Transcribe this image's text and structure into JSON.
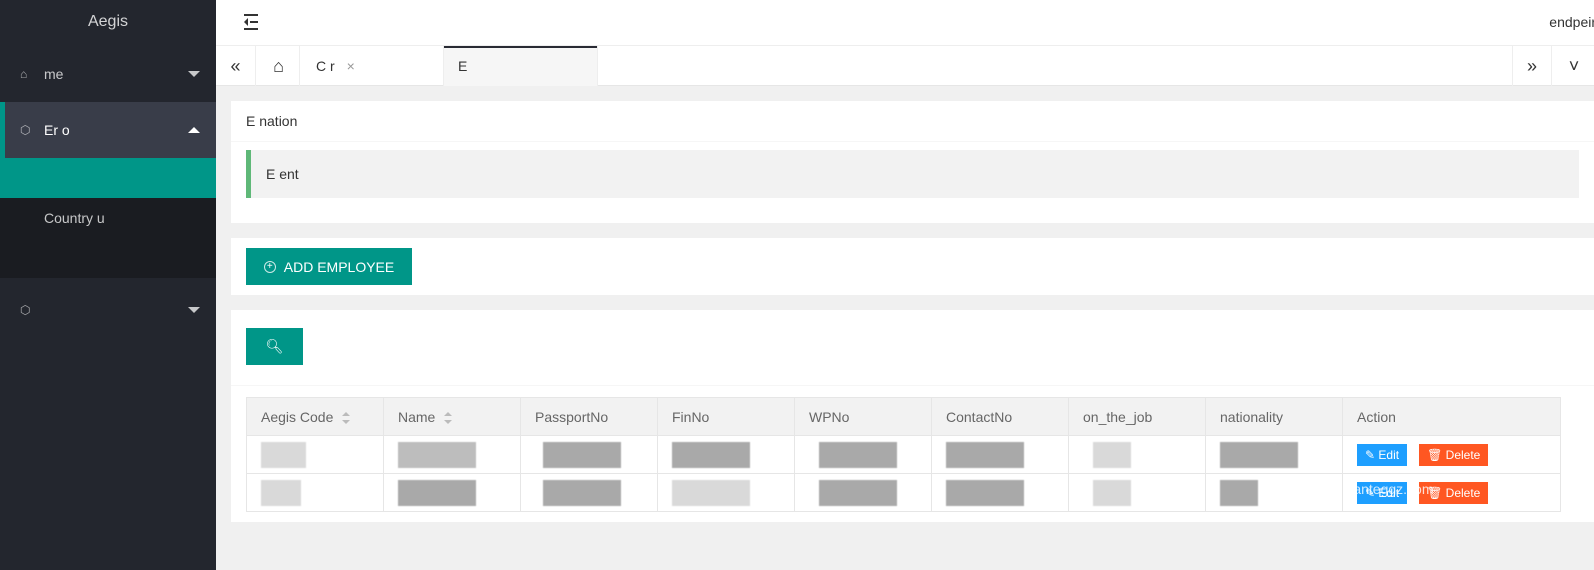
{
  "app": {
    "title": "Aegis",
    "user": "endpeir"
  },
  "sidebar": {
    "items": [
      {
        "label": "me",
        "icon": "home-icon"
      },
      {
        "label": "Er          o",
        "icon": "cube-icon"
      },
      {
        "label": "",
        "icon": "cube-icon"
      }
    ],
    "sub_items": [
      {
        "label": ""
      },
      {
        "label": "Country   u"
      },
      {
        "label": ""
      }
    ]
  },
  "tabs": {
    "items": [
      {
        "label": "C           r"
      },
      {
        "label": "E"
      }
    ]
  },
  "info": {
    "title": "E          nation",
    "quote": "E                                                                ent"
  },
  "toolbar": {
    "add_label": "ADD EMPLOYEE"
  },
  "table": {
    "headers": [
      "Aegis Code",
      "Name",
      "PassportNo",
      "FinNo",
      "WPNo",
      "ContactNo",
      "on_the_job",
      "nationality",
      "Action"
    ],
    "edit_label": "✎ Edit",
    "delete_label": "🗑 Delete"
  },
  "watermark": "w.wanteggz.com",
  "colors": {
    "accent": "#009688",
    "sidebar_bg": "#23262e",
    "edit": "#1e9fff",
    "delete": "#ff5722"
  }
}
